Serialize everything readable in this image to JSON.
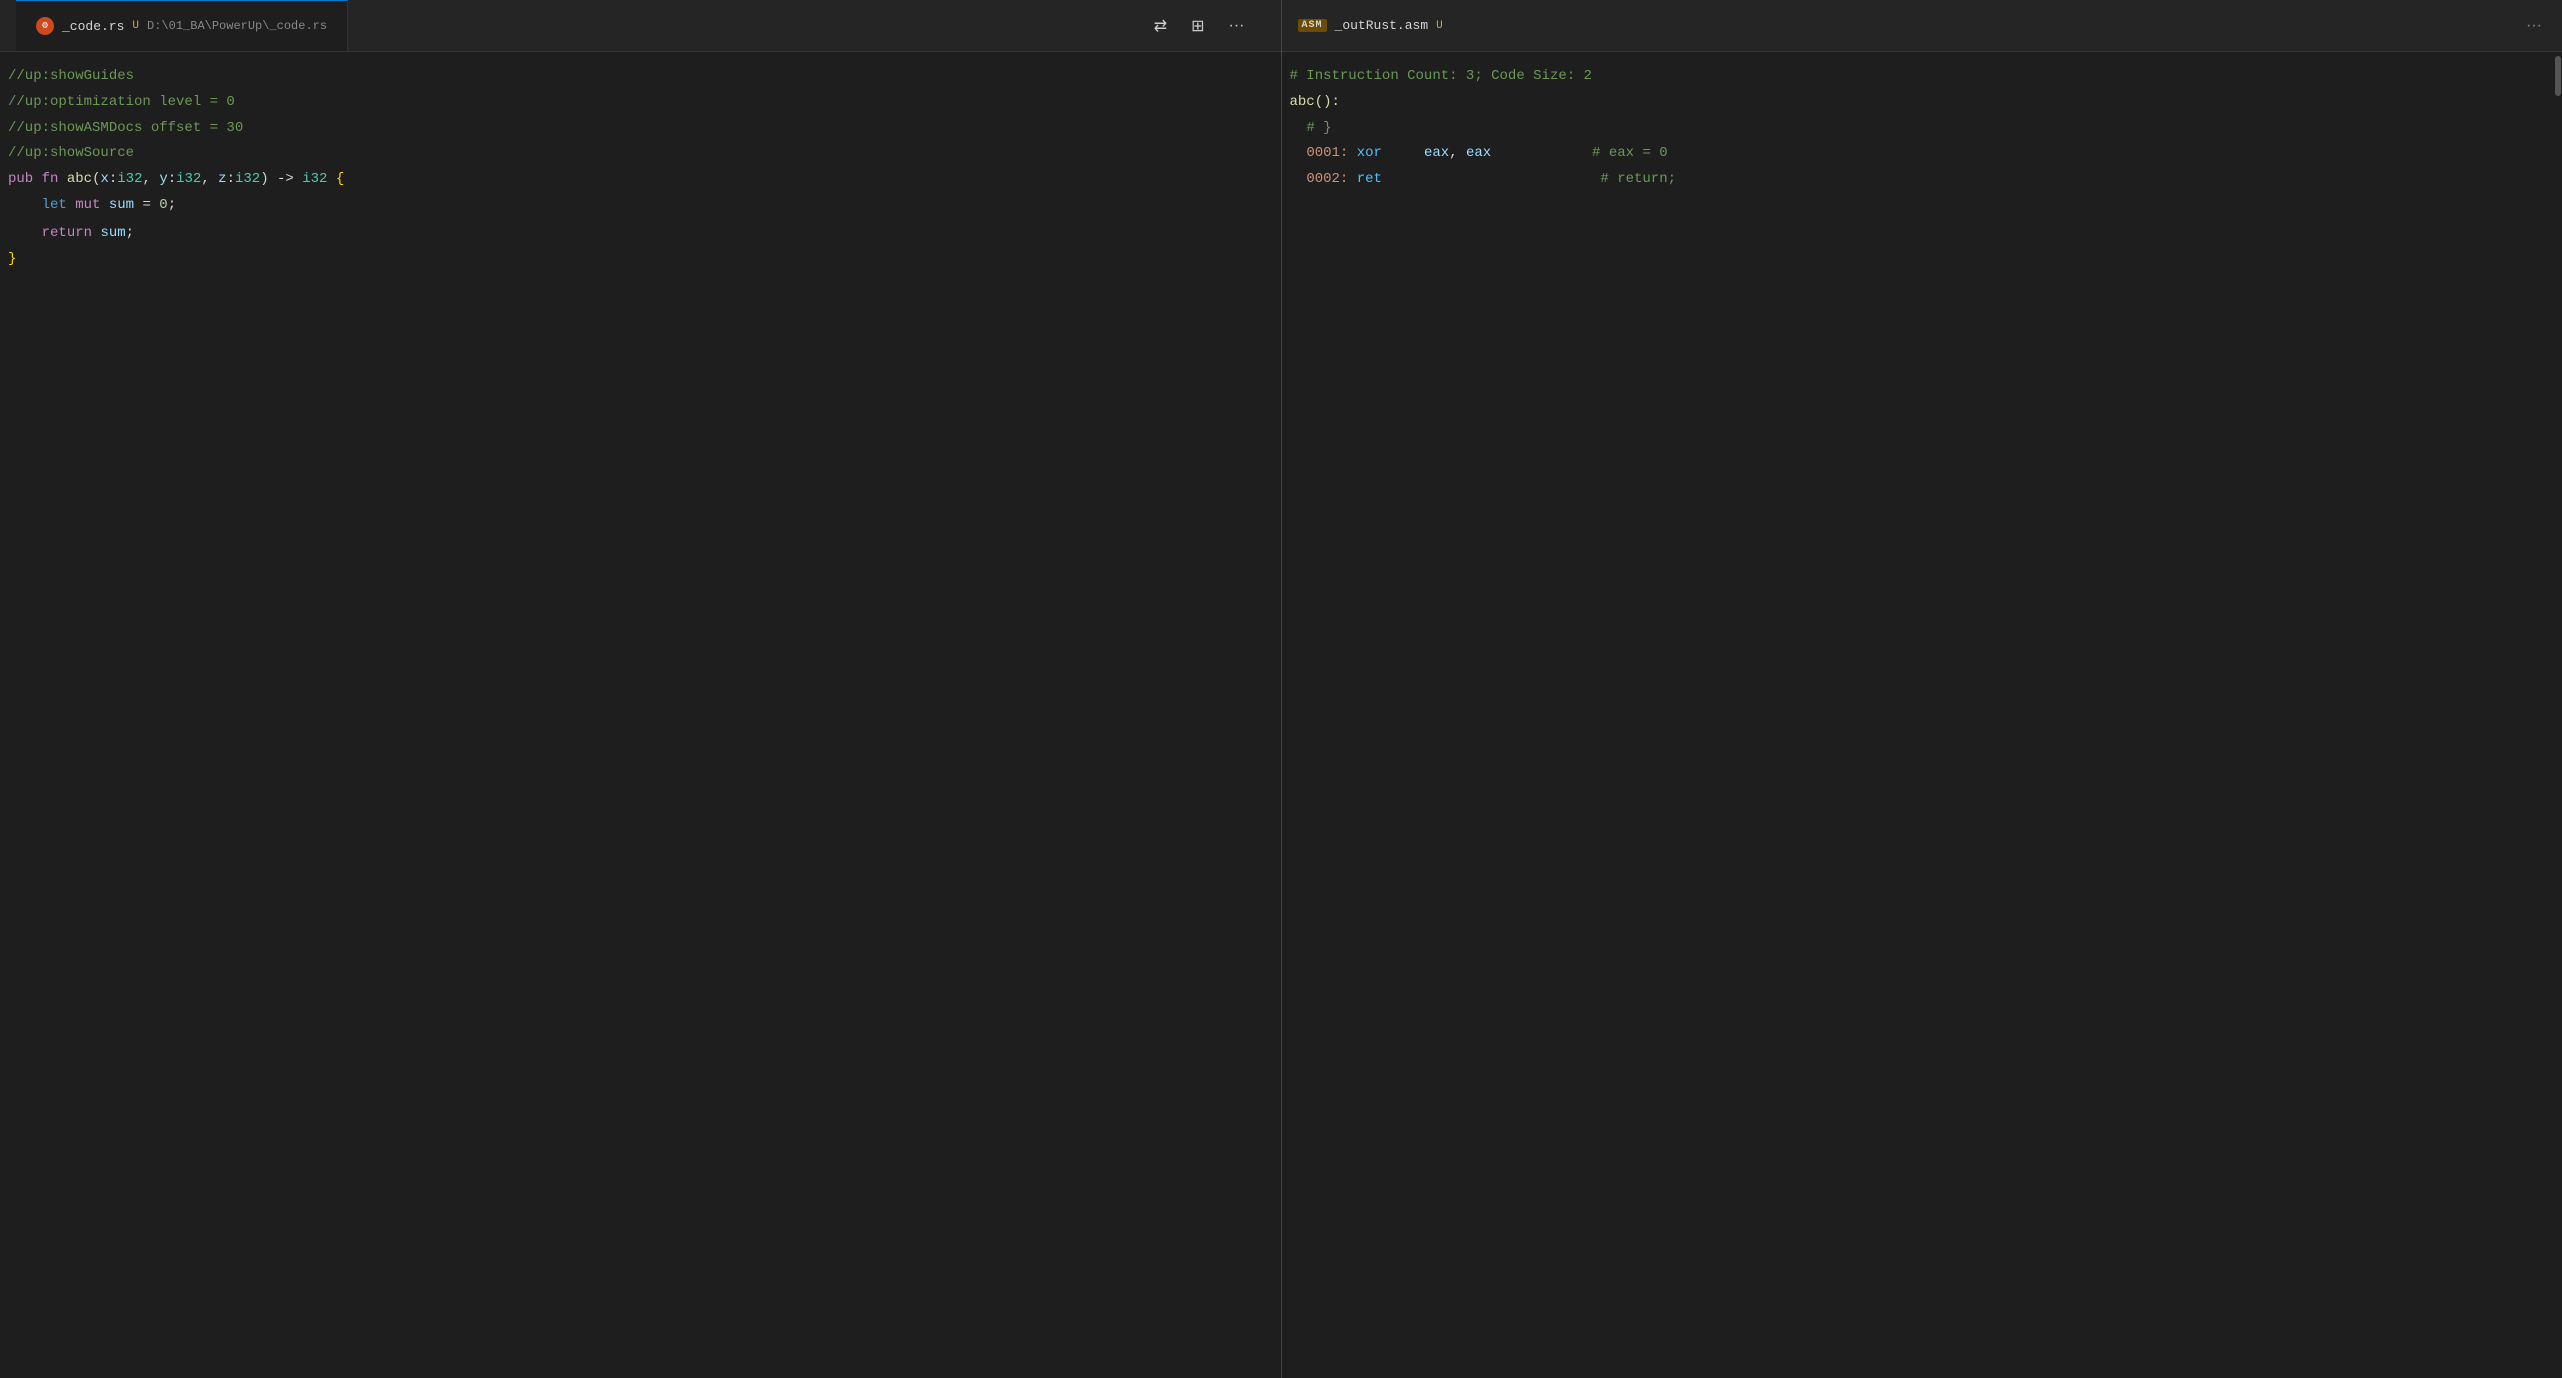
{
  "left_pane": {
    "tab": {
      "icon": "rust",
      "filename": "_code.rs",
      "modified": "U",
      "path": "D:\\01_BA\\PowerUp\\_code.rs"
    },
    "toolbar": {
      "sync_btn": "⇄",
      "split_btn": "⊞",
      "more_btn": "···"
    },
    "lines": [
      {
        "num": "",
        "content_html": "<span class='c-comment'>//up:showGuides</span>"
      },
      {
        "num": "",
        "content_html": "<span class='c-comment'>//up:optimization level = 0</span>"
      },
      {
        "num": "",
        "content_html": "<span class='c-comment'>//up:showASMDocs offset = 30</span>"
      },
      {
        "num": "",
        "content_html": "<span class='c-comment'>//up:showSource</span>"
      },
      {
        "num": "",
        "content_html": "<span class='c-keyword'>pub</span> <span class='c-keyword'>fn</span> <span class='c-fn-name'>abc</span><span class='c-punctuation'>(</span><span class='c-param'>x</span><span class='c-punctuation'>:</span><span class='c-type'>i32</span><span class='c-punctuation'>,</span> <span class='c-param'>y</span><span class='c-punctuation'>:</span><span class='c-type'>i32</span><span class='c-punctuation'>,</span> <span class='c-param'>z</span><span class='c-punctuation'>:</span><span class='c-type'>i32</span><span class='c-punctuation'>)</span> <span class='c-arrow'>-></span> <span class='c-type'>i32</span> <span class='c-brace'>{</span>"
      },
      {
        "num": "",
        "content_html": "    <span class='c-let'>let</span> <span class='c-mut'>mut</span> <span class='c-variable'>sum</span> <span class='c-operator'>=</span> <span class='c-number'>0</span><span class='c-punctuation'>;</span>"
      },
      {
        "num": "",
        "content_html": ""
      },
      {
        "num": "",
        "content_html": "    <span class='c-keyword'>return</span> <span class='c-variable'>sum</span><span class='c-punctuation'>;</span>"
      },
      {
        "num": "",
        "content_html": "<span class='c-brace'>}</span>"
      }
    ]
  },
  "right_pane": {
    "tab": {
      "badge": "ASM",
      "filename": "_outRust.asm",
      "modified": "U"
    },
    "toolbar": {
      "more_btn": "···"
    },
    "lines": [
      {
        "content_html": "<span class='asm-hash'># Instruction Count: 3; Code Size: 2</span>"
      },
      {
        "content_html": "<span class='asm-label'>abc()</span><span class='c-punctuation'>:</span>"
      },
      {
        "content_html": "  <span class='asm-hash'># }</span>"
      },
      {
        "content_html": "  <span class='asm-addr'>0001:</span> <span class='asm-mnemonic'>xor</span>     <span class='asm-register'>eax</span><span class='c-punctuation'>,</span> <span class='asm-register'>eax</span>            <span class='asm-hash'># eax = 0</span>"
      },
      {
        "content_html": "  <span class='asm-addr'>0002:</span> <span class='asm-mnemonic'>ret</span>                          <span class='asm-hash'># return;</span>"
      }
    ]
  }
}
